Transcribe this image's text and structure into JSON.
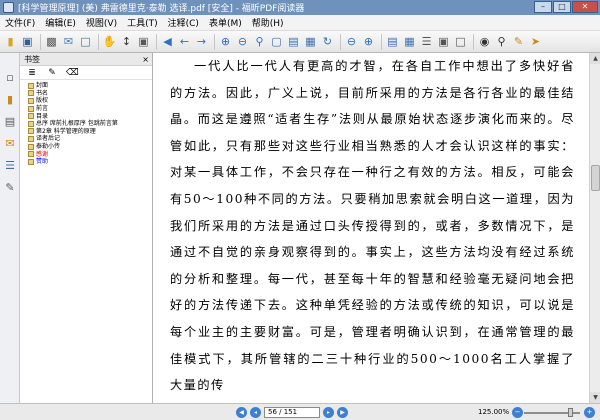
{
  "window": {
    "title": "[科学管理原理] (美) 弗雷德里克·泰勒 选译.pdf [安全] - 福昕PDF阅读器",
    "min": "–",
    "max": "□",
    "close": "✕"
  },
  "menu": [
    "文件(F)",
    "编辑(E)",
    "视图(V)",
    "工具(T)",
    "注释(C)",
    "表单(M)",
    "帮助(H)"
  ],
  "bookmarks": {
    "header": "书签",
    "close": "×",
    "tools": [
      "≣",
      "✎",
      "⌫"
    ],
    "items": [
      {
        "label": "封面",
        "style": "normal"
      },
      {
        "label": "书名",
        "style": "normal"
      },
      {
        "label": "版权",
        "style": "normal"
      },
      {
        "label": "前言",
        "style": "normal"
      },
      {
        "label": "目录",
        "style": "normal"
      },
      {
        "label": "总序  席前扎根厚序  包跳前言第",
        "style": "normal"
      },
      {
        "label": "第2章  科学管理的原理",
        "style": "normal"
      },
      {
        "label": "译者后记",
        "style": "normal"
      },
      {
        "label": "泰勒小传",
        "style": "normal"
      },
      {
        "label": "感谢",
        "style": "red"
      },
      {
        "label": "赞助",
        "style": "blue"
      }
    ]
  },
  "document": {
    "text": "一代人比一代人有更高的才智，在各自工作中想出了多快好省的方法。因此，广义上说，目前所采用的方法是各行各业的最佳结晶。而这是遵照“适者生存”法则从最原始状态逐步演化而来的。尽管如此，只有那些对这些行业相当熟悉的人才会认识这样的事实：对某一具体工作，不会只存在一种行之有效的方法。相反，可能会有50～100种不同的方法。只要稍加思索就会明白这一道理，因为我们所采用的方法是通过口头传授得到的，或者，多数情况下，是通过不自觉的亲身观察得到的。事实上，这些方法均没有经过系统的分析和整理。每一代，甚至每十年的智慧和经验毫无疑问地会把好的方法传递下去。这种单凭经验的方法或传统的知识，可以说是每个业主的主要财富。可是，管理者明确认识到，在通常管理的最佳模式下，其所管辖的二三十种行业的500～1000名工人掌握了大量的传"
  },
  "status": {
    "page": "56 / 151",
    "zoom": "125.00%"
  },
  "icons": {
    "toolbar": [
      "folder-open-icon",
      "save-icon",
      "print-icon",
      "email-icon",
      "single-page-icon",
      "hand-tool-icon",
      "select-text-icon",
      "snapshot-icon",
      "first-page-icon",
      "prev-page-icon",
      "next-page-icon",
      "last-page-icon",
      "zoom-in-icon",
      "zoom-out-icon",
      "fit-page-icon",
      "rotate-icon",
      "find-icon",
      "bookmark-icon",
      "comment-icon"
    ]
  }
}
